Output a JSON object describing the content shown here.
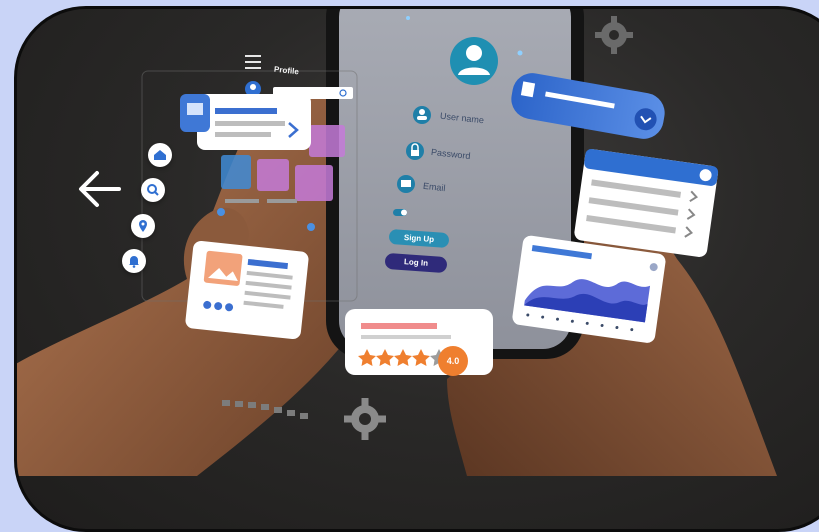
{
  "phone": {
    "username_label": "User name",
    "password_label": "Password",
    "email_label": "Email",
    "sign_up_label": "Sign Up",
    "log_in_label": "Log In"
  },
  "profile_panel": {
    "title": "Profile"
  },
  "rating_card": {
    "rating_value": "4.0",
    "stars_filled": 4,
    "stars_total": 5
  },
  "nav_icons": [
    "home-icon",
    "search-icon",
    "location-icon",
    "bell-icon"
  ],
  "icons": [
    "arrow-left-icon",
    "hamburger-menu-icon",
    "gear-icon",
    "user-avatar-icon",
    "lock-icon",
    "mail-icon",
    "image-icon",
    "chevron-right-icon",
    "chevron-down-icon"
  ],
  "colors": {
    "background": "#c9d4f7",
    "frame_border": "#0c0c0c",
    "accent_blue": "#2f6fd1",
    "accent_teal": "#2a8fb4",
    "accent_orange": "#ef7f2f",
    "tile_purple": "#c47ad8",
    "log_in_button": "#2f2a7a"
  }
}
